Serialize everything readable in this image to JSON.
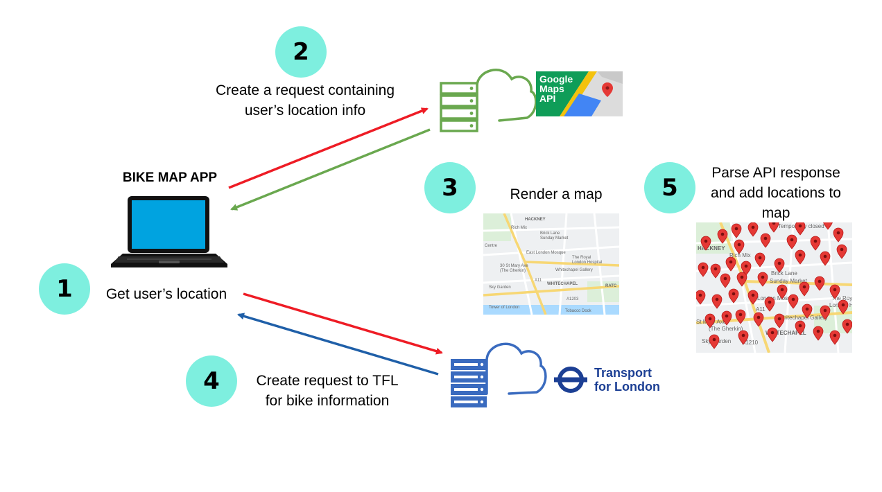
{
  "colors": {
    "step_circle": "#7eefdf",
    "arrow_red": "#ee1c25",
    "arrow_green": "#6aa84f",
    "arrow_blue": "#1f5fa8",
    "server_green": "#6aa84f",
    "server_blue": "#3a6bbf",
    "laptop_screen": "#00a3e0",
    "tfl_blue": "#1c3f94",
    "marker_red": "#e53935"
  },
  "app": {
    "title": "BIKE MAP APP"
  },
  "steps": [
    {
      "number": "1",
      "label": "Get user’s location"
    },
    {
      "number": "2",
      "label_line1": "Create a request containing",
      "label_line2": "user’s location info"
    },
    {
      "number": "3",
      "label": "Render a map"
    },
    {
      "number": "4",
      "label_line1": "Create request to TFL",
      "label_line2": "for bike information"
    },
    {
      "number": "5",
      "label_line1": "Parse API response",
      "label_line2": "and add locations to",
      "label_line3": "map"
    }
  ],
  "google_badge": {
    "line1": "Google",
    "line2": "Maps",
    "line3": "API"
  },
  "tfl": {
    "line1": "Transport",
    "line2": "for London"
  },
  "icons": {
    "laptop": "laptop-icon",
    "google_server": "cloud-server-icon",
    "tfl_server": "cloud-server-icon",
    "map_pin": "map-pin-icon",
    "tfl_roundel": "tfl-roundel-icon"
  },
  "map_small": {
    "labels": [
      "HACKNEY",
      "Rich Mix",
      "Brick Lane Sunday Market",
      "East London Mosque",
      "30 St Mary Axe (The Gherkin)",
      "Whitechapel Gallery",
      "The Royal London Hospital",
      "WHITECHAPEL",
      "Sky Garden",
      "Tower of London",
      "Tobacco Dock",
      "Centre",
      "A11",
      "A1203",
      "RATC"
    ]
  },
  "map_large": {
    "labels": [
      "HACKNEY",
      "Rich Mix",
      "Brick Lane Sunday Market",
      "London Mosque",
      "St Mary Axe (The Gherkin)",
      "Whitechapel Gallery",
      "The Royal London Hospital",
      "WHITECHAPEL",
      "Sky Garden",
      "Temporarily closed",
      "A11",
      "A1210"
    ]
  }
}
